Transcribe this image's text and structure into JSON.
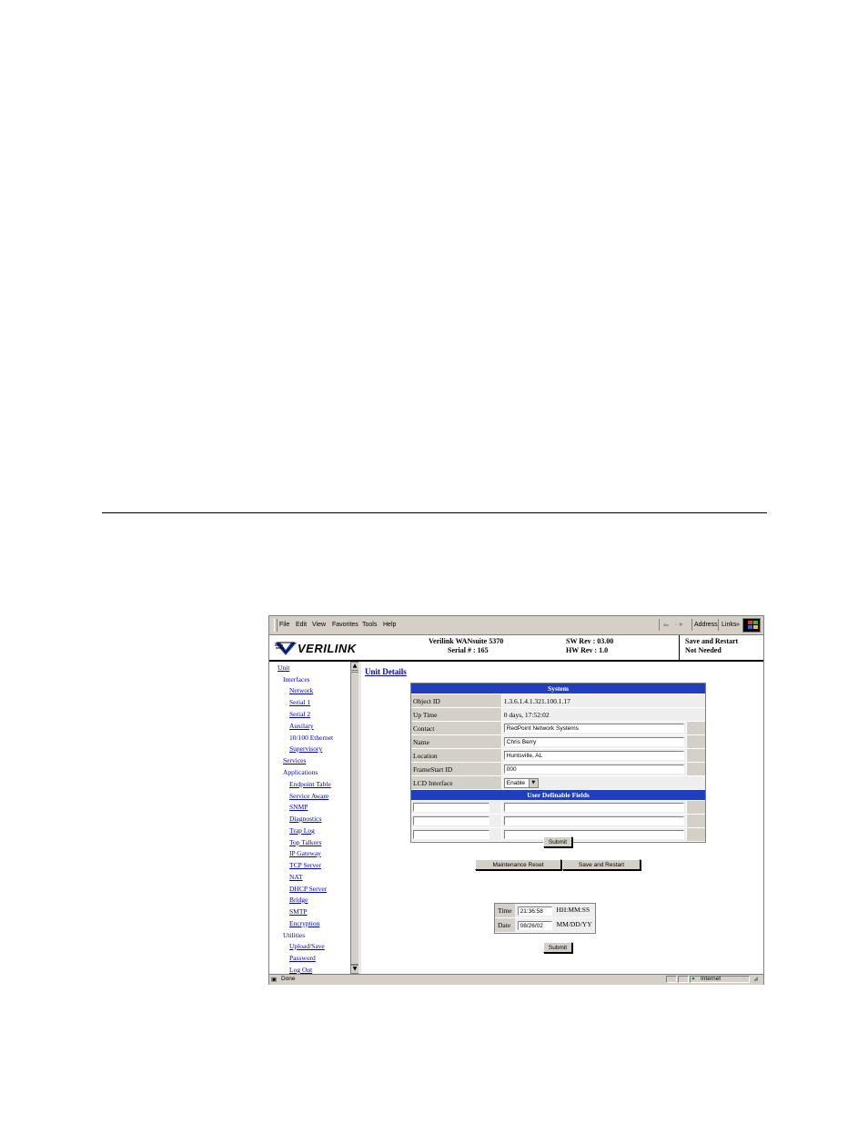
{
  "menu": {
    "items": [
      "File",
      "Edit",
      "View",
      "Favorites",
      "Tools",
      "Help"
    ],
    "nav_back": "⇦",
    "nav_arrows": "· »",
    "address_label": "Address",
    "links_label": "Links",
    "links_chevron": "»"
  },
  "header": {
    "logo_text": "VERILINK",
    "product": "Verilink WANsuite 5370",
    "serial": "Serial # : 165",
    "sw_rev": "SW Rev : 03.00",
    "hw_rev": "HW Rev : 1.0",
    "save_status_line1": "Save and Restart",
    "save_status_line2": "Not Needed"
  },
  "sidebar": {
    "unit": "Unit",
    "interfaces": "Interfaces",
    "interface_items": [
      "Network",
      "Serial 1",
      "Serial 2",
      "Auxilary",
      "10/100 Ethernet",
      "Supervisory"
    ],
    "services": "Services",
    "applications": "Applications",
    "application_items": [
      "Endpoint Table",
      "Service Aware",
      "SNMP",
      "Diagnostics",
      "Trap Log",
      "Top Talkers",
      "IP Gateway",
      "TCP Server",
      "NAT",
      "DHCP Server",
      "Bridge",
      "SMTP",
      "Encryption"
    ],
    "utilities": "Utilities",
    "utility_items": [
      "Upload/Save",
      "Password",
      "Log Out"
    ]
  },
  "scrollbar": {
    "up": "▲",
    "down": "▼"
  },
  "main": {
    "title": "Unit Details",
    "system_header": "System",
    "object_id_label": "Object ID",
    "object_id": "1.3.6.1.4.1.321.100.1.17",
    "uptime_label": "Up Time",
    "uptime": "0 days, 17:52:02",
    "contact_label": "Contact",
    "contact": "RedPoint Network Systems",
    "name_label": "Name",
    "name": "Chris Berry",
    "location_label": "Location",
    "location": "Huntsville, AL",
    "framestart_label": "FrameStart ID",
    "framestart": "000",
    "lcd_label": "LCD Interface",
    "lcd_value": "Enable",
    "lcd_arrow": "▼",
    "udf_header": "User Definable Fields",
    "submit1": "Submit",
    "maintenance_reset": "Maintenance Reset",
    "save_restart": "Save and Restart",
    "time_label": "Time",
    "time_value": "21:36:58",
    "time_format": "HH:MM:SS",
    "date_label": "Date",
    "date_value": "08/26/02",
    "date_format": "MM/DD/YY",
    "submit2": "Submit"
  },
  "status": {
    "done": "Done",
    "zone": "Internet"
  },
  "colors": {
    "table_band": "#1f3fbf",
    "link": "#0000cc",
    "chrome": "#d4d0c8"
  }
}
